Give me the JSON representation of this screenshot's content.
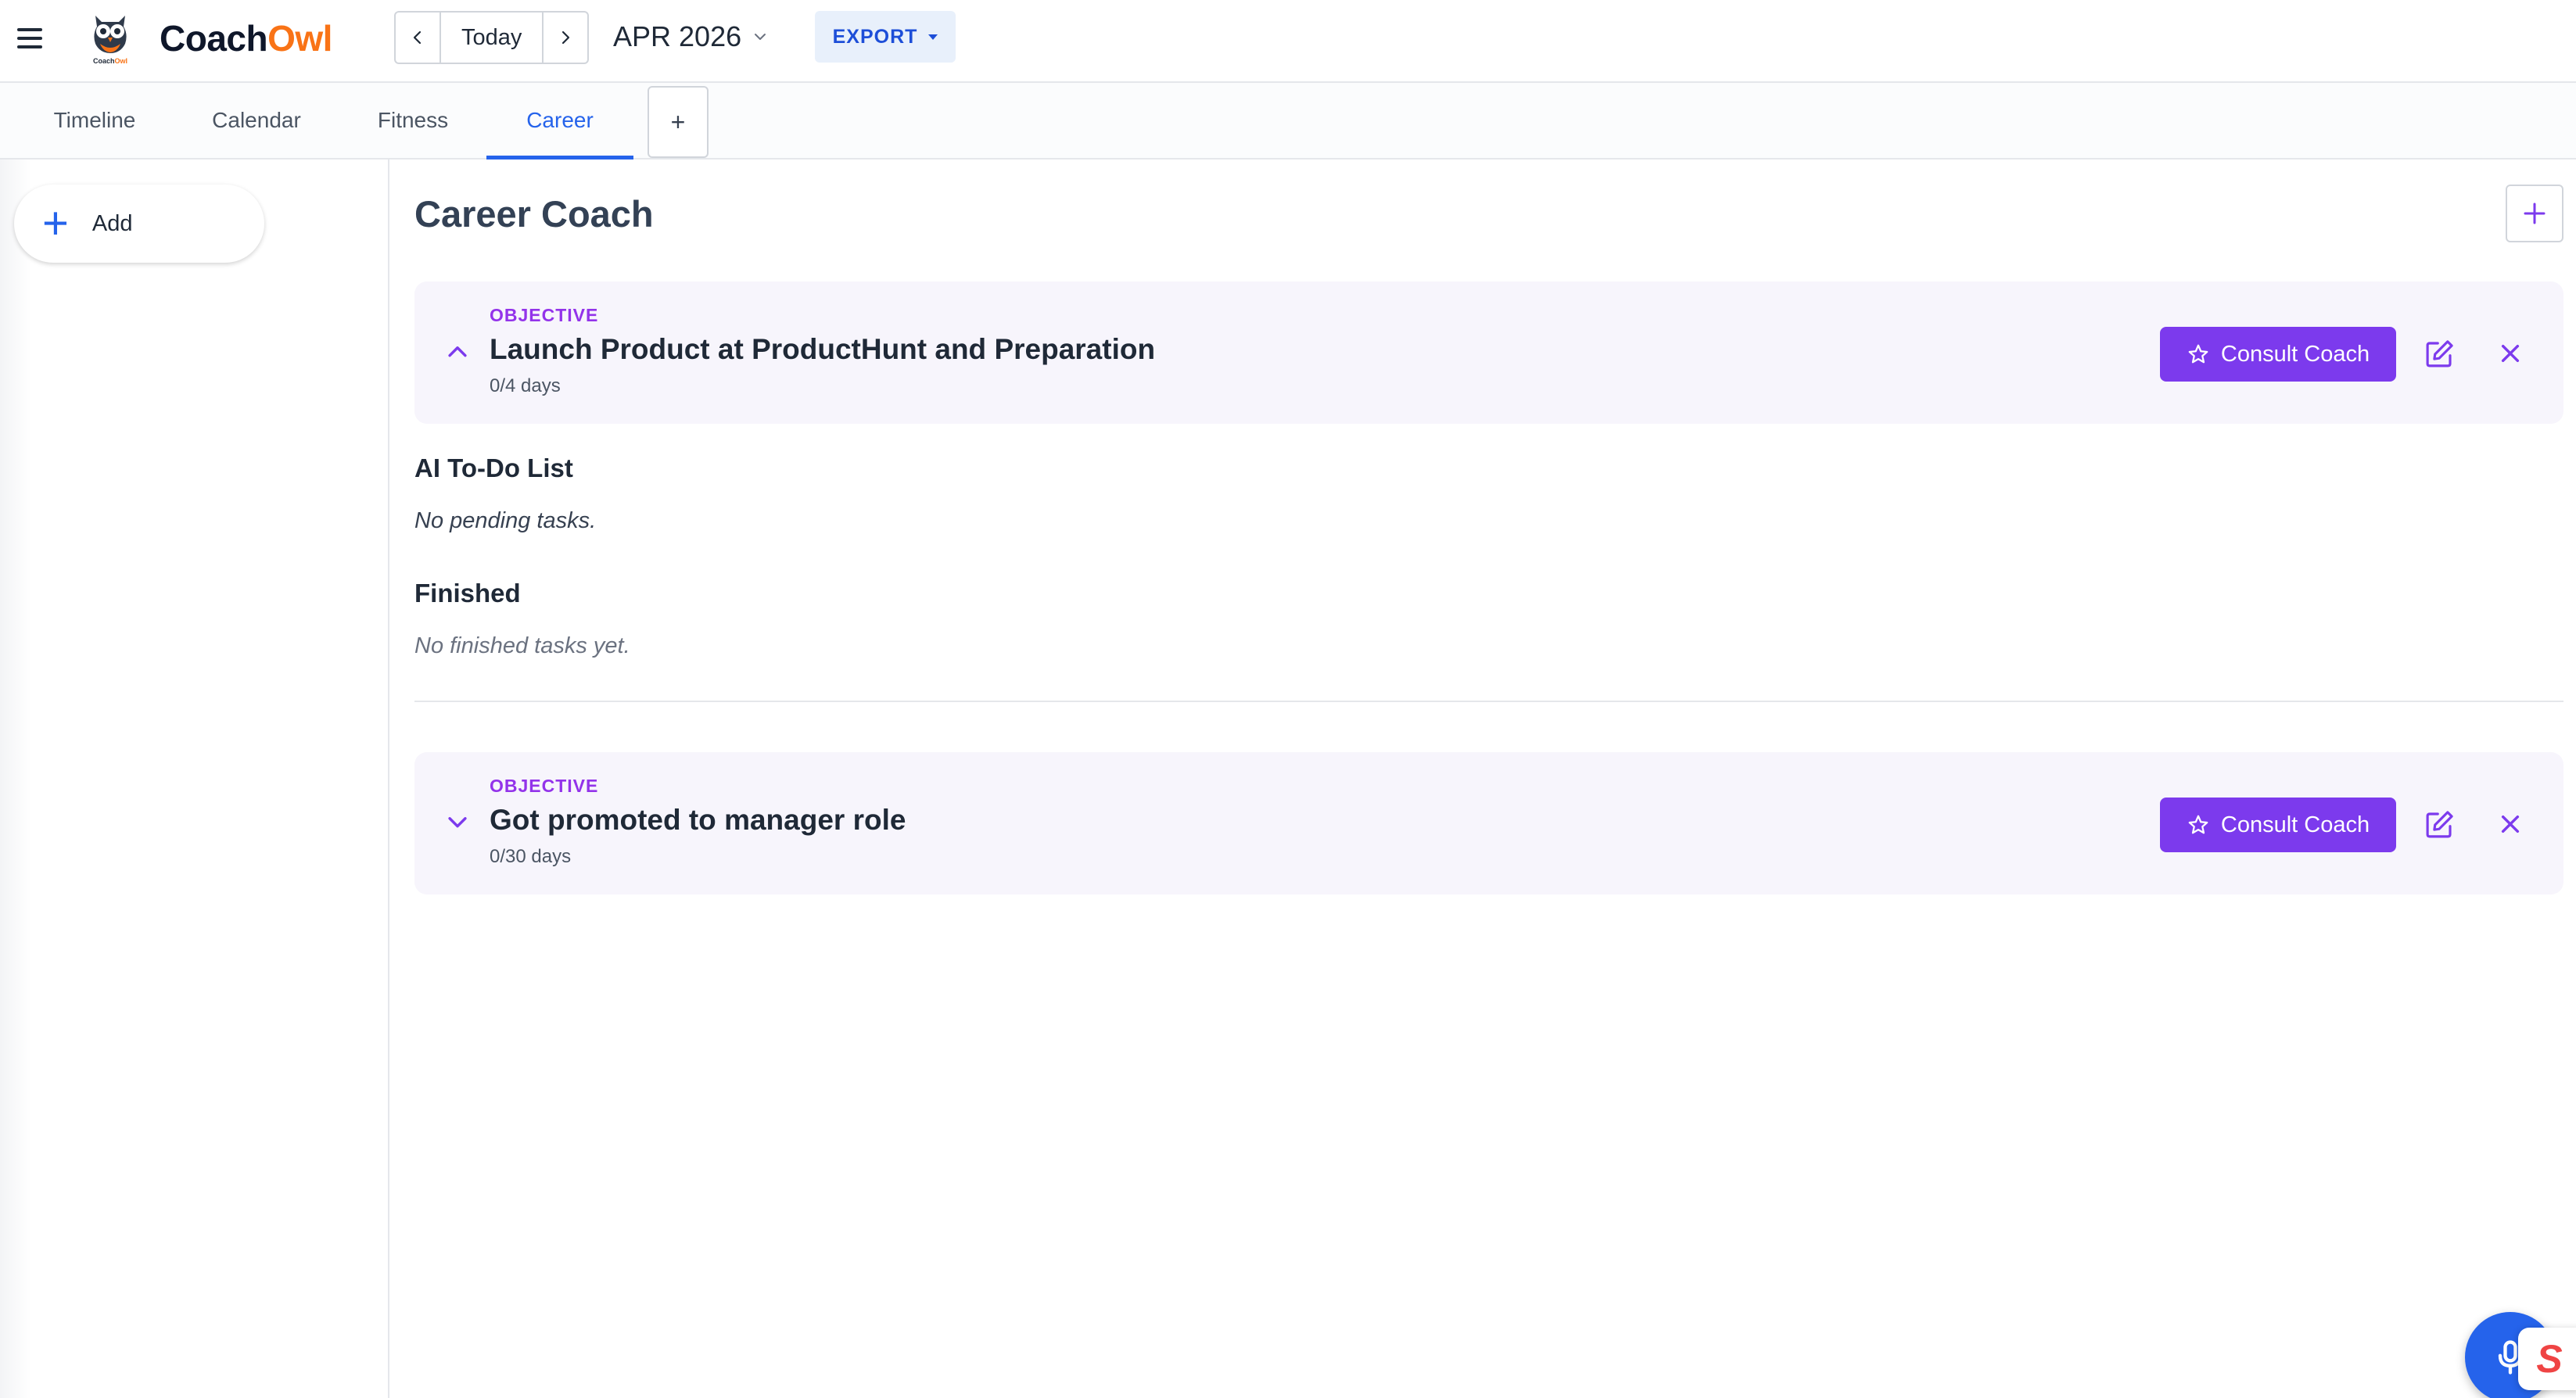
{
  "header": {
    "menu_icon": "hamburger-menu-icon",
    "logo_icon": "owl-logo-icon",
    "logo_caption": "CoachOwl",
    "brand_part1": "Coach",
    "brand_part2": "Owl",
    "today_label": "Today",
    "month_label": "APR 2026",
    "export_label": "EXPORT"
  },
  "tabs": [
    {
      "label": "Timeline",
      "active": false
    },
    {
      "label": "Calendar",
      "active": false
    },
    {
      "label": "Fitness",
      "active": false
    },
    {
      "label": "Career",
      "active": true
    }
  ],
  "tab_add_label": "+",
  "sidebar": {
    "add_label": "Add"
  },
  "main": {
    "title": "Career Coach",
    "objectives": [
      {
        "label": "OBJECTIVE",
        "title": "Launch Product at ProductHunt and Preparation",
        "days": "0/4 days",
        "expanded": true,
        "consult_label": "Consult Coach"
      },
      {
        "label": "OBJECTIVE",
        "title": "Got promoted to manager role",
        "days": "0/30 days",
        "expanded": false,
        "consult_label": "Consult Coach"
      }
    ],
    "todo_heading": "AI To-Do List",
    "todo_empty": "No pending tasks.",
    "finished_heading": "Finished",
    "finished_empty": "No finished tasks yet."
  },
  "colors": {
    "accent_blue": "#2563eb",
    "accent_purple": "#7c3aed",
    "brand_orange": "#f97316"
  }
}
